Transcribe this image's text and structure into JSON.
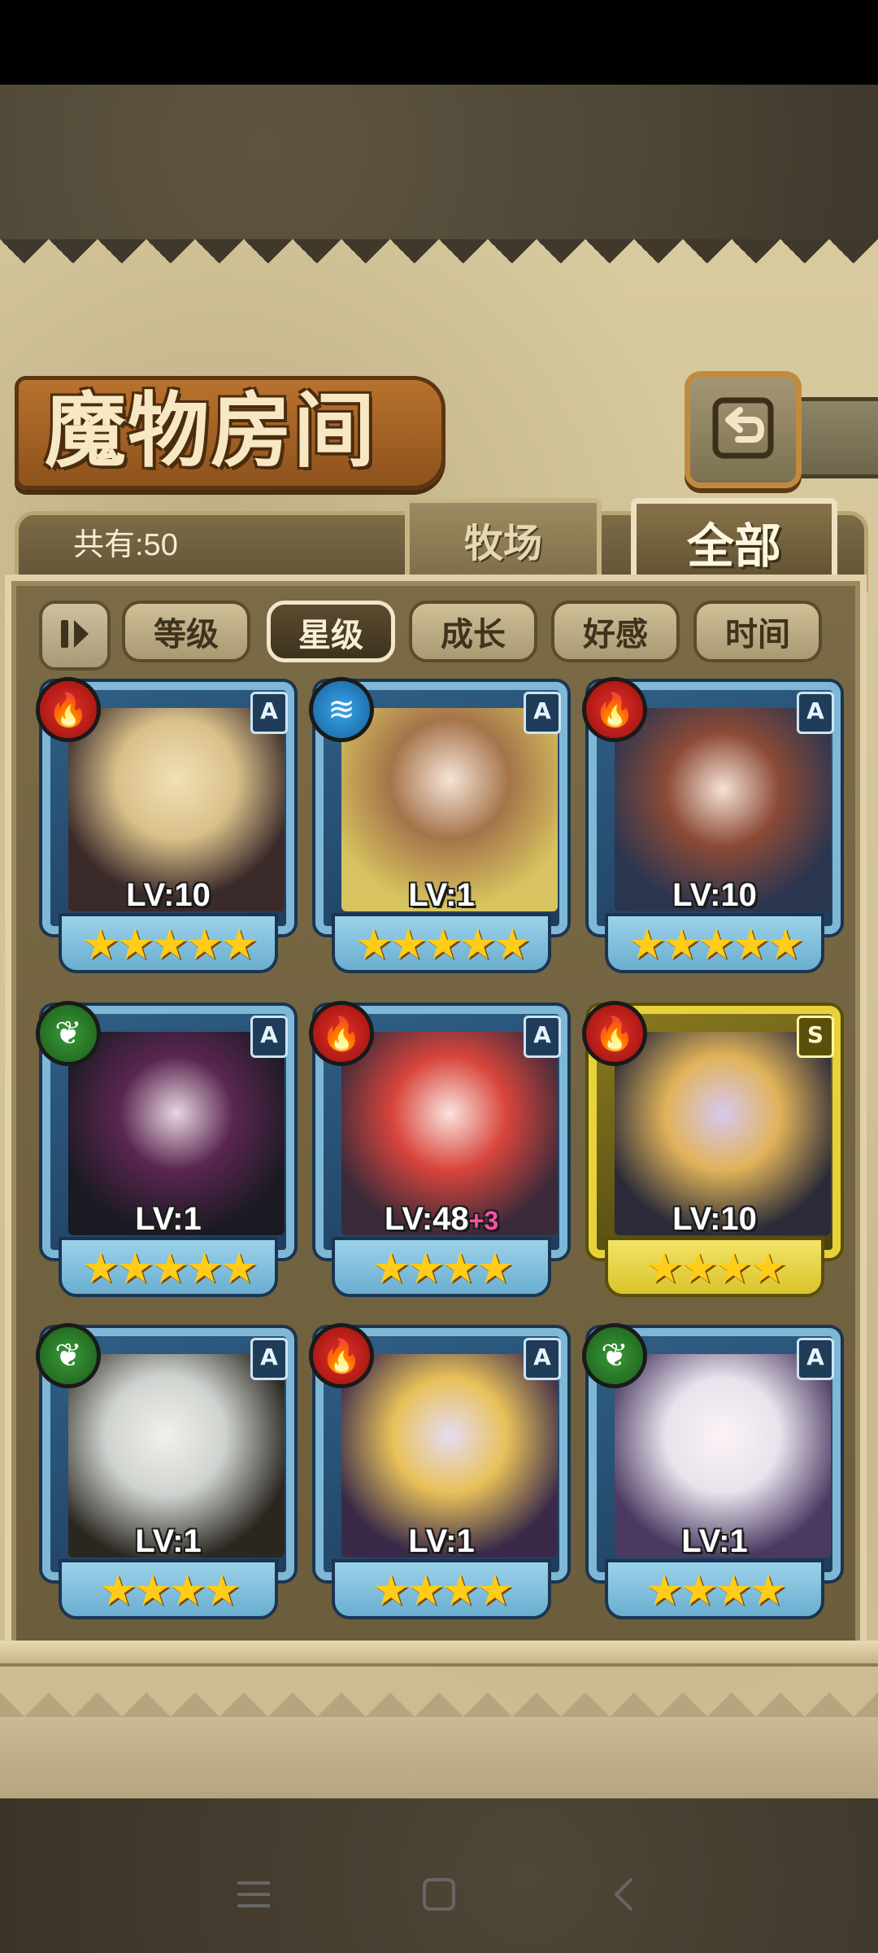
{
  "header": {
    "title": "魔物房间",
    "back_icon": "back-arrow-icon"
  },
  "summary": {
    "count_text": "共有:50"
  },
  "tabs": [
    {
      "label": "牧场",
      "active": false
    },
    {
      "label": "全部",
      "active": true
    }
  ],
  "sort": {
    "toggle_icon": "sort-order-icon",
    "buttons": [
      {
        "label": "等级",
        "active": false
      },
      {
        "label": "星级",
        "active": true
      },
      {
        "label": "成长",
        "active": false
      },
      {
        "label": "好感",
        "active": false
      },
      {
        "label": "时间",
        "active": false
      }
    ]
  },
  "monsters": [
    {
      "element": "fire",
      "rank": "A",
      "level": "LV:10",
      "bonus": "",
      "stars": 5
    },
    {
      "element": "water",
      "rank": "A",
      "level": "LV:1",
      "bonus": "",
      "stars": 5
    },
    {
      "element": "fire",
      "rank": "A",
      "level": "LV:10",
      "bonus": "",
      "stars": 5
    },
    {
      "element": "wood",
      "rank": "A",
      "level": "LV:1",
      "bonus": "",
      "stars": 5
    },
    {
      "element": "fire",
      "rank": "A",
      "level": "LV:48",
      "bonus": "+3",
      "stars": 4
    },
    {
      "element": "fire",
      "rank": "S",
      "level": "LV:10",
      "bonus": "",
      "stars": 4
    },
    {
      "element": "wood",
      "rank": "A",
      "level": "LV:1",
      "bonus": "",
      "stars": 4
    },
    {
      "element": "fire",
      "rank": "A",
      "level": "LV:1",
      "bonus": "",
      "stars": 4
    },
    {
      "element": "wood",
      "rank": "A",
      "level": "LV:1",
      "bonus": "",
      "stars": 4
    }
  ],
  "colors": {
    "fire": "#c81e1a",
    "water": "#2a88cc",
    "wood": "#2c7a2a",
    "card_frame": "#7fb7d6",
    "card_frame_s": "#e8d23a",
    "star": "#ffcc1a",
    "bonus": "#ff4fa5"
  },
  "nav": {
    "menu_icon": "menu-icon",
    "home_icon": "home-icon",
    "back_icon": "back-icon"
  }
}
